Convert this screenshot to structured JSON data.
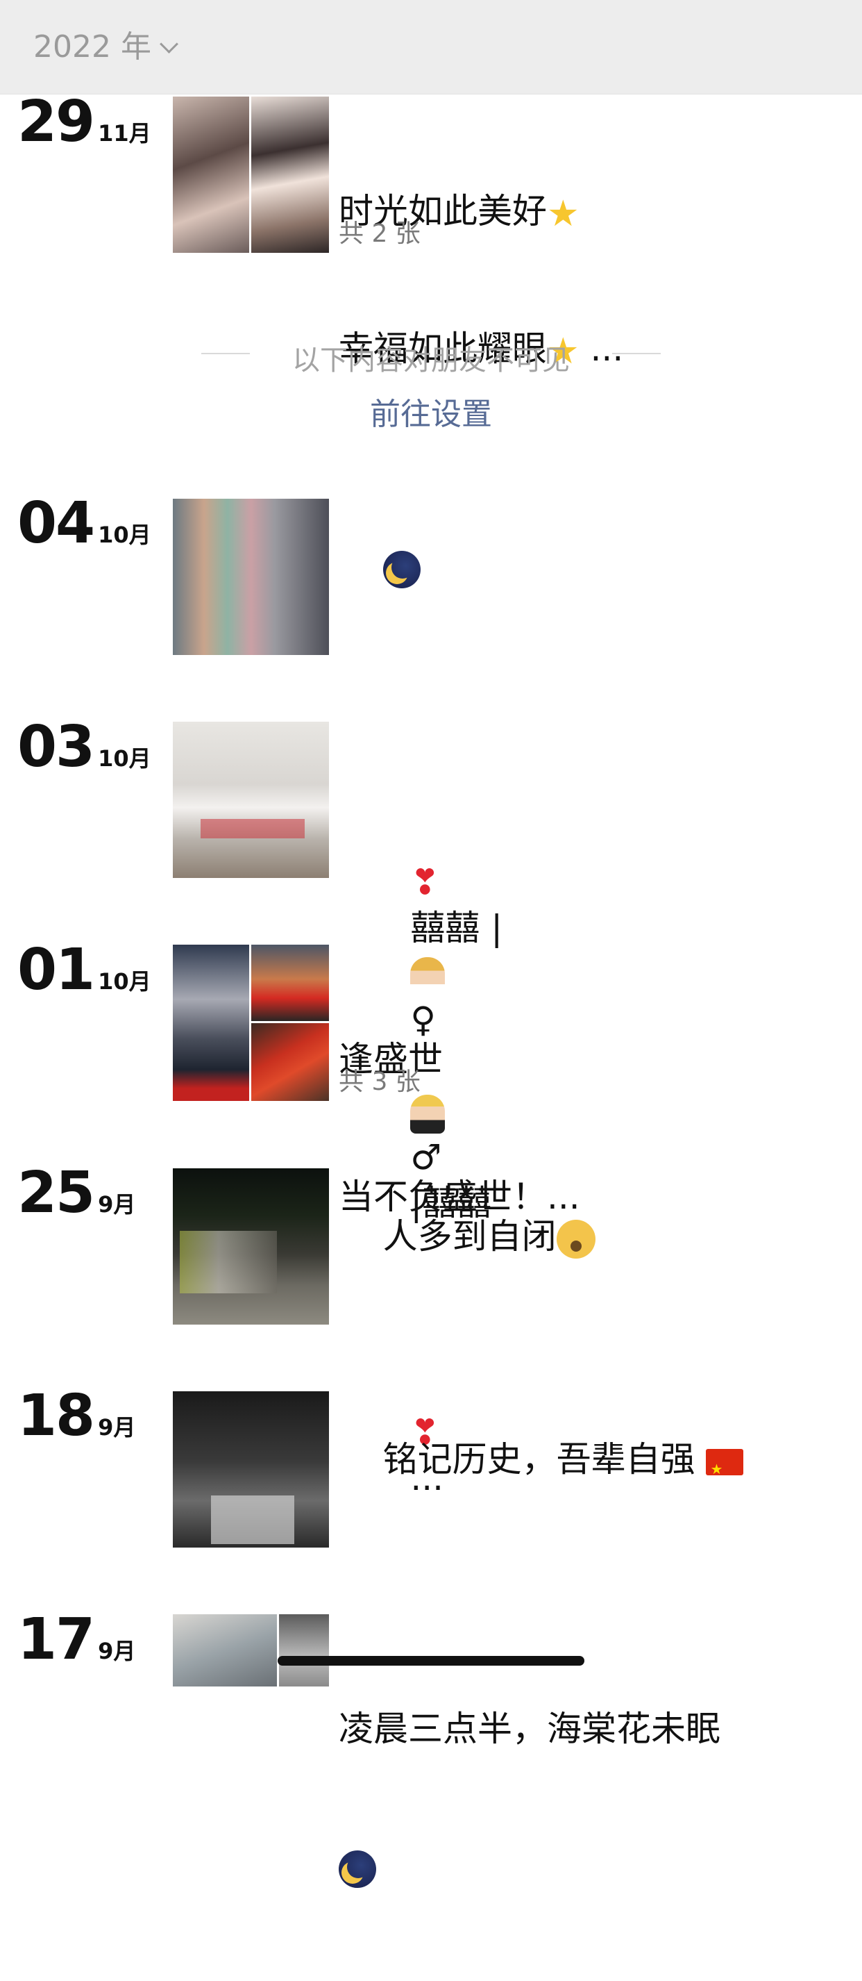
{
  "header": {
    "year_label": "2022 年"
  },
  "divider": {
    "label": "以下内容对朋友不可见",
    "link": "前往设置"
  },
  "posts": [
    {
      "day": "29",
      "month": "11月",
      "line1": "时光如此美好",
      "line2": "幸福如此耀眼",
      "ellipsis": "...",
      "count": "共 2 张"
    },
    {
      "day": "04",
      "month": "10月"
    },
    {
      "day": "03",
      "month": "10月",
      "text_a": "囍囍 |",
      "text_b": "♀",
      "text_c": "♂",
      "text_d": "|囍囍",
      "ellipsis": "..."
    },
    {
      "day": "01",
      "month": "10月",
      "line1": "逢盛世",
      "line2": "当不负盛世！...",
      "count": "共 3 张"
    },
    {
      "day": "25",
      "month": "9月",
      "text": "人多到自闭"
    },
    {
      "day": "18",
      "month": "9月",
      "text": "铭记历史，吾辈自强"
    },
    {
      "day": "17",
      "month": "9月",
      "text": "凌晨三点半，海棠花未眠"
    }
  ],
  "icons": {
    "star": "star-icon",
    "moon": "crescent-moon-icon",
    "heart": "heart-exclamation-icon",
    "bride": "bride-icon",
    "groom": "groom-icon",
    "flag": "china-flag-icon",
    "face": "zipper-mouth-face-icon"
  },
  "colors": {
    "link": "#576b95",
    "muted": "#9a9a9a",
    "header_bg": "#ededed"
  }
}
